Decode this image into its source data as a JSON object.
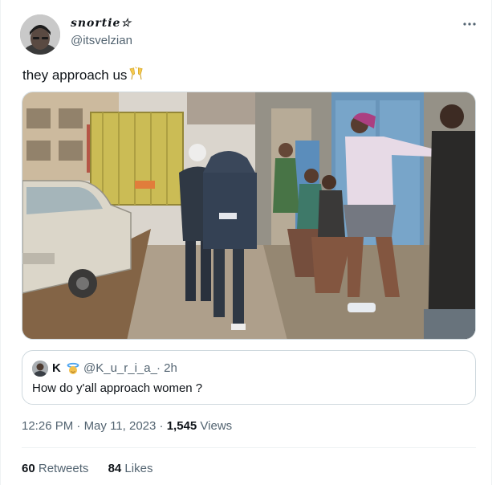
{
  "tweet": {
    "author": {
      "display_name": "snortie☆",
      "handle": "@itsvelzian"
    },
    "text": "they approach us",
    "text_emoji": "clinking-glasses",
    "media": {
      "description_icon": "photo"
    },
    "quoted": {
      "name": "K",
      "badge_icon": "halo-emoji",
      "handle": "@K_u_r_i_a_",
      "time": "· 2h",
      "text": "How do y'all approach women ?"
    },
    "meta": {
      "time": "12:26 PM",
      "separator": "·",
      "date": "May 11, 2023",
      "views_count": "1,545",
      "views_label": "Views"
    },
    "stats": {
      "retweets_count": "60",
      "retweets_label": "Retweets",
      "likes_count": "84",
      "likes_label": "Likes"
    }
  },
  "colors": {
    "text_primary": "#0f1419",
    "text_secondary": "#536471",
    "border": "#cfd9de"
  }
}
